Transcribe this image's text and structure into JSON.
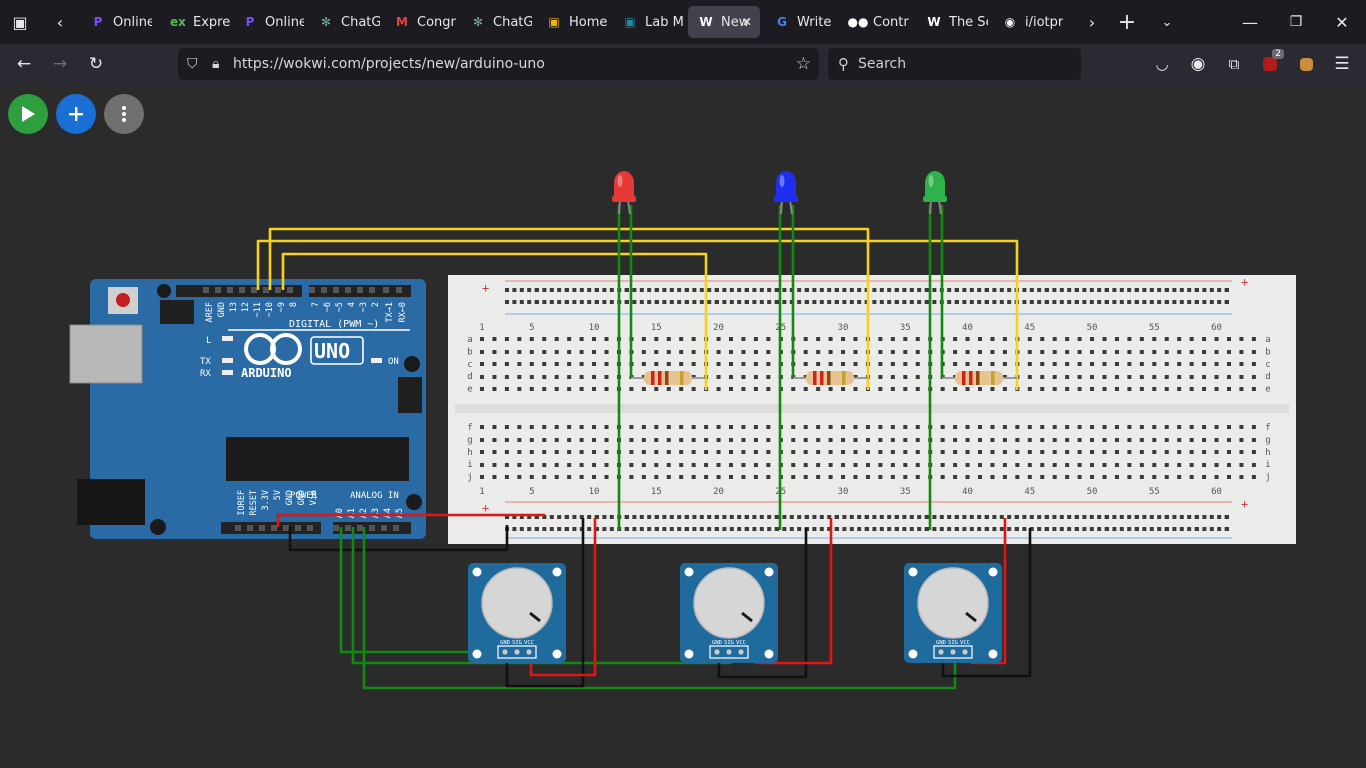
{
  "browser": {
    "tabs": [
      {
        "label": "Online",
        "icon": "p-logo-icon",
        "color": "#7c4dff"
      },
      {
        "label": "Express",
        "icon": "express-icon",
        "color": "#5ab552"
      },
      {
        "label": "Online",
        "icon": "p-logo-icon",
        "color": "#7c4dff"
      },
      {
        "label": "ChatGPT",
        "icon": "openai-icon",
        "color": "#74aa9c"
      },
      {
        "label": "Congr",
        "icon": "gmail-icon",
        "color": "#ea4335"
      },
      {
        "label": "ChatGPT",
        "icon": "openai-icon",
        "color": "#74aa9c"
      },
      {
        "label": "Home",
        "icon": "classroom-icon",
        "color": "#f4b400"
      },
      {
        "label": "Lab M",
        "icon": "classroom-icon",
        "color": "#1e8e9e"
      },
      {
        "label": "New",
        "icon": "wokwi-icon",
        "color": "#ffffff"
      },
      {
        "label": "Write",
        "icon": "google-icon",
        "color": "#4285f4"
      },
      {
        "label": "Contr",
        "icon": "medium-icon",
        "color": "#ffffff"
      },
      {
        "label": "The Se",
        "icon": "wikipedia-icon",
        "color": "#ffffff"
      },
      {
        "label": "i/iotpr",
        "icon": "github-icon",
        "color": "#ffffff"
      }
    ],
    "url": "https://wokwi.com/projects/new/arduino-uno",
    "search_placeholder": "Search",
    "extension_badge": "2"
  },
  "toolbar": {
    "run_icon": "play-icon",
    "add_icon": "plus-icon",
    "menu_icon": "more-vertical-icon"
  },
  "arduino": {
    "model": "UNO",
    "brand": "ARDUINO",
    "digital_label": "DIGITAL (PWM ~)",
    "power_label": "POWER",
    "analog_label": "ANALOG IN",
    "led_l": "L",
    "led_tx": "TX",
    "led_rx": "RX",
    "led_on": "ON",
    "top_pins": [
      "AREF",
      "GND",
      "13",
      "12",
      "~11",
      "~10",
      "~9",
      "8",
      "7",
      "~6",
      "~5",
      "4",
      "~3",
      "2",
      "TX→1",
      "RX←0"
    ],
    "power_pins": [
      "IOREF",
      "RESET",
      "3.3V",
      "5V",
      "GND",
      "GND",
      "Vin"
    ],
    "analog_pins": [
      "A0",
      "A1",
      "A2",
      "A3",
      "A4",
      "A5"
    ]
  },
  "breadboard": {
    "column_numbers": [
      "1",
      "5",
      "10",
      "15",
      "20",
      "25",
      "30",
      "35",
      "40",
      "45",
      "50",
      "55",
      "60"
    ],
    "rows_top": [
      "a",
      "b",
      "c",
      "d",
      "e"
    ],
    "rows_bottom": [
      "f",
      "g",
      "h",
      "i",
      "j"
    ],
    "plus": "+",
    "minus": "-"
  },
  "components": {
    "leds": [
      {
        "color": "#e53935"
      },
      {
        "color": "#1e2ff0"
      },
      {
        "color": "#2fb24c"
      }
    ],
    "potentiometer_pins": [
      "GND",
      "SIG",
      "VCC"
    ]
  },
  "colors": {
    "wire_yellow": "#f7d21a",
    "wire_green": "#128a12",
    "wire_red": "#e01515",
    "wire_black": "#111111",
    "board_blue": "#2a6aa5"
  }
}
